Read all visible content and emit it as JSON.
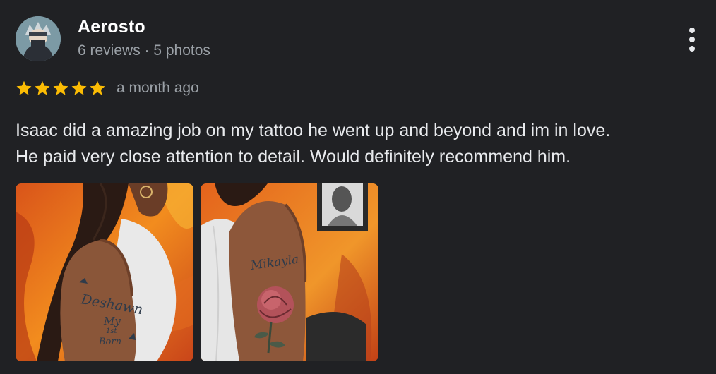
{
  "author": {
    "name": "Aerosto",
    "meta": "6 reviews · 5 photos"
  },
  "rating": {
    "stars": 5,
    "max": 5,
    "date": "a month ago",
    "star_color": "#fbbc04"
  },
  "review": {
    "text_line1": "Isaac did a amazing job on my tattoo he went up and beyond and im in love.",
    "text_line2": "He paid very close attention to detail. Would definitely recommend him."
  },
  "photos": [
    {
      "tattoo_text_top": "Deshawn",
      "tattoo_text_mid": "My",
      "tattoo_text_mid2": "1st",
      "tattoo_text_bot": "Born"
    },
    {
      "tattoo_text_top": "Mikayla"
    }
  ],
  "colors": {
    "background": "#202124",
    "primary_text": "#e8eaed",
    "secondary_text": "#9aa0a6"
  },
  "icons": {
    "menu": "more-vert-icon",
    "star": "star-icon"
  }
}
